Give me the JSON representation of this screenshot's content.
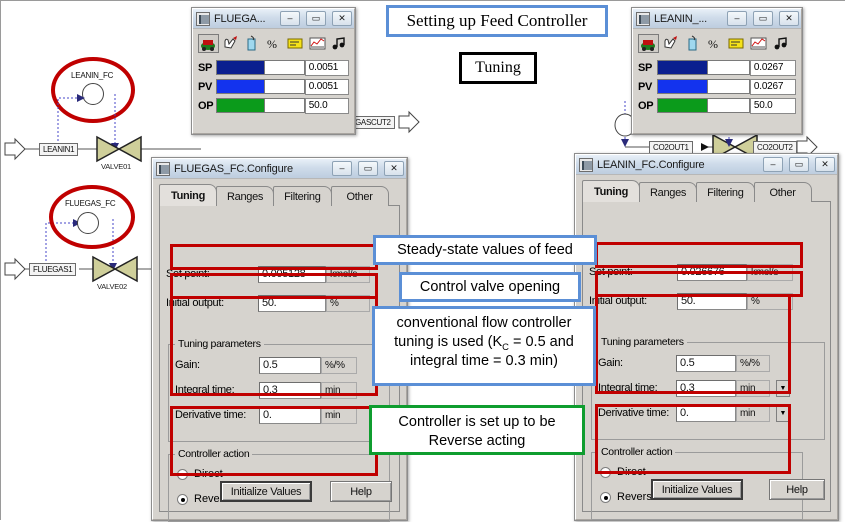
{
  "flowsheet": {
    "controllers": [
      {
        "name": "LEANIN_FC"
      },
      {
        "name": "FLUEGAS_FC"
      }
    ],
    "streams": [
      {
        "name": "LEANIN1"
      },
      {
        "name": "FLUEGAS1"
      },
      {
        "name": "GASCUT2"
      },
      {
        "name": "CO2OUT1"
      },
      {
        "name": "CO2OUT2"
      }
    ],
    "valves": [
      {
        "name": "VALVE01"
      },
      {
        "name": "VALVE02"
      }
    ]
  },
  "faceplate_left": {
    "title": "FLUEGA...",
    "minimize": "–",
    "maximize": "▭",
    "close": "✕",
    "rows": [
      {
        "tag": "SP",
        "value": "0.0051",
        "color": "#0b1f8f"
      },
      {
        "tag": "PV",
        "value": "0.0051",
        "color": "#1333ee"
      },
      {
        "tag": "OP",
        "value": "50.0",
        "color": "#0b9b1b"
      }
    ],
    "tools": [
      {
        "name": "faceplate-view-icon"
      },
      {
        "name": "hand-pointer-icon"
      },
      {
        "name": "manual-mode-icon"
      },
      {
        "name": "percent-icon"
      },
      {
        "name": "notes-icon"
      },
      {
        "name": "trend-chart-icon"
      },
      {
        "name": "sound-icon"
      }
    ]
  },
  "faceplate_right": {
    "title": "LEANIN_...",
    "minimize": "–",
    "maximize": "▭",
    "close": "✕",
    "rows": [
      {
        "tag": "SP",
        "value": "0.0267",
        "color": "#0b1f8f"
      },
      {
        "tag": "PV",
        "value": "0.0267",
        "color": "#1333ee"
      },
      {
        "tag": "OP",
        "value": "50.0",
        "color": "#0b9b1b"
      }
    ]
  },
  "dialog_left": {
    "title": "FLUEGAS_FC.Configure",
    "minimize": "–",
    "maximize": "▭",
    "close": "✕",
    "tabs": [
      {
        "label": "Tuning",
        "active": true
      },
      {
        "label": "Ranges",
        "active": false
      },
      {
        "label": "Filtering",
        "active": false
      },
      {
        "label": "Other",
        "active": false
      }
    ],
    "setpoint_label": "Set point:",
    "setpoint_value": "0.005128",
    "setpoint_unit": "kmol/s",
    "initial_output_label": "Initial output:",
    "initial_output_value": "50.",
    "initial_output_unit": "%",
    "tuning_group_title": "Tuning parameters",
    "gain_label": "Gain:",
    "gain_value": "0.5",
    "gain_unit": "%/%",
    "integral_label": "Integral time:",
    "integral_value": "0.3",
    "integral_unit": "min",
    "derivative_label": "Derivative time:",
    "derivative_value": "0.",
    "derivative_unit": "min",
    "action_group_title": "Controller action",
    "action_direct": "Direct",
    "action_reverse": "Reverse",
    "action_selected": "Reverse",
    "initialize_button": "Initialize Values",
    "help_button": "Help"
  },
  "dialog_right": {
    "title": "LEANIN_FC.Configure",
    "minimize": "–",
    "maximize": "▭",
    "close": "✕",
    "tabs": [
      {
        "label": "Tuning",
        "active": true
      },
      {
        "label": "Ranges",
        "active": false
      },
      {
        "label": "Filtering",
        "active": false
      },
      {
        "label": "Other",
        "active": false
      }
    ],
    "setpoint_label": "Set point:",
    "setpoint_value": "0.026676",
    "setpoint_unit": "kmol/s",
    "initial_output_label": "Initial output:",
    "initial_output_value": "50.",
    "initial_output_unit": "%",
    "tuning_group_title": "Tuning parameters",
    "gain_label": "Gain:",
    "gain_value": "0.5",
    "gain_unit": "%/%",
    "integral_label": "Integral time:",
    "integral_value": "0.3",
    "integral_unit": "min",
    "derivative_label": "Derivative time:",
    "derivative_value": "0.",
    "derivative_unit": "min",
    "action_group_title": "Controller action",
    "action_direct": "Direct",
    "action_reverse": "Reverse",
    "action_selected": "Reverse",
    "initialize_button": "Initialize Values",
    "help_button": "Help",
    "spinner_glyph": "▼"
  },
  "annotations": {
    "heading": "Setting up Feed Controller",
    "subheading": "Tuning",
    "steady_state": "Steady-state values of feed",
    "valve_opening": "Control valve opening",
    "tuning_line1": "conventional flow controller",
    "tuning_line2_a": "tuning is used (K",
    "tuning_line2_sub": "C",
    "tuning_line2_b": " = 0.5 and",
    "tuning_line3": "integral time = 0.3 min)",
    "reverse_line1": "Controller is set up to be",
    "reverse_line2": "Reverse acting"
  },
  "colors": {
    "highlight_red": "#c00000",
    "callout_blue": "#5b8fd6",
    "callout_green": "#0f9d2f"
  }
}
